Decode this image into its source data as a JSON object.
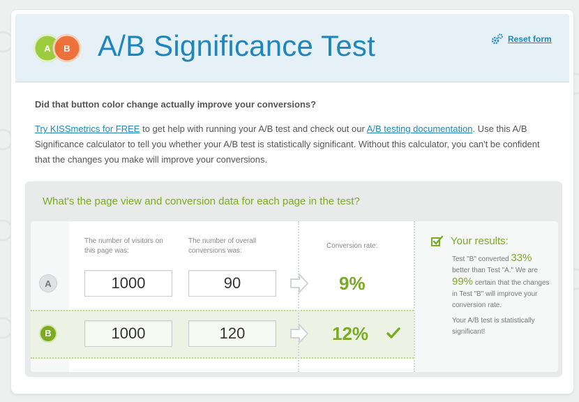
{
  "header": {
    "logo_a": "A",
    "logo_b": "B",
    "title": "A/B Significance Test",
    "reset_label": "Reset form",
    "reset_icon": "gear-icon"
  },
  "intro": {
    "question": "Did that button color change actually improve your conversions?",
    "link1": "Try KISSmetrics for FREE",
    "text1": " to get help with running your A/B test and check out our ",
    "link2": "A/B testing documentation",
    "text2": ". Use this A/B Significance calculator to tell you whether your A/B test is statistically significant. Without this calculator, you can't be confident that the changes you make will improve your conversions."
  },
  "panel": {
    "heading": "What's the page view and conversion data for each page in the test?",
    "col_visitors": "The number of visitors on this page was:",
    "col_conversions": "The number of overall conversions was:",
    "col_rate": "Conversion rate:",
    "rows": [
      {
        "label": "A",
        "visitors": "1000",
        "conversions": "90",
        "rate": "9%"
      },
      {
        "label": "B",
        "visitors": "1000",
        "conversions": "120",
        "rate": "12%"
      }
    ]
  },
  "results": {
    "title": "Your results:",
    "p1": "Test \"B\" converted",
    "pct1": "33%",
    "p2": "better than Test \"A.\" We are",
    "pct2": "99%",
    "p3": "certain that the changes in Test \"B\" will improve your conversion rate.",
    "conclusion": "Your A/B test is statistically significant!"
  },
  "colors": {
    "accent_blue": "#1f86bd",
    "accent_green": "#7aab22",
    "logo_a": "#9ccc3d",
    "logo_b": "#ee6b31"
  }
}
